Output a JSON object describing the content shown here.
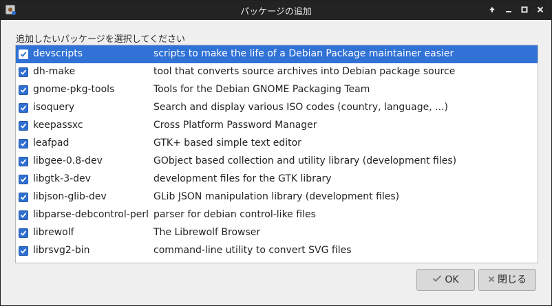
{
  "window": {
    "title": "パッケージの追加"
  },
  "titlebar": {
    "buttons": [
      "up-arrow-icon",
      "minimize-icon",
      "maximize-icon",
      "close-icon"
    ]
  },
  "prompt": "追加したいパッケージを選択してください",
  "packages": [
    {
      "name": "devscripts",
      "description": "scripts to make the life of a Debian Package maintainer easier",
      "checked": true,
      "selected": true
    },
    {
      "name": "dh-make",
      "description": "tool that converts source archives into Debian package source",
      "checked": true,
      "selected": false
    },
    {
      "name": "gnome-pkg-tools",
      "description": "Tools for the Debian GNOME Packaging Team",
      "checked": true,
      "selected": false
    },
    {
      "name": "isoquery",
      "description": "Search and display various ISO codes (country, language, ...)",
      "checked": true,
      "selected": false
    },
    {
      "name": "keepassxc",
      "description": "Cross Platform Password Manager",
      "checked": true,
      "selected": false
    },
    {
      "name": "leafpad",
      "description": "GTK+ based simple text editor",
      "checked": true,
      "selected": false
    },
    {
      "name": "libgee-0.8-dev",
      "description": "GObject based collection and utility library (development files)",
      "checked": true,
      "selected": false
    },
    {
      "name": "libgtk-3-dev",
      "description": "development files for the GTK library",
      "checked": true,
      "selected": false
    },
    {
      "name": "libjson-glib-dev",
      "description": "GLib JSON manipulation library (development files)",
      "checked": true,
      "selected": false
    },
    {
      "name": "libparse-debcontrol-perl",
      "description": "parser for debian control-like files",
      "checked": true,
      "selected": false
    },
    {
      "name": "librewolf",
      "description": "The Librewolf Browser",
      "checked": true,
      "selected": false
    },
    {
      "name": "librsvg2-bin",
      "description": "command-line utility to convert SVG files",
      "checked": true,
      "selected": false
    }
  ],
  "buttons": {
    "ok_label": "OK",
    "close_label": "閉じる"
  },
  "colors": {
    "selection": "#3072d6",
    "checkbox": "#2f6fd0",
    "titlebar": "#232323"
  }
}
